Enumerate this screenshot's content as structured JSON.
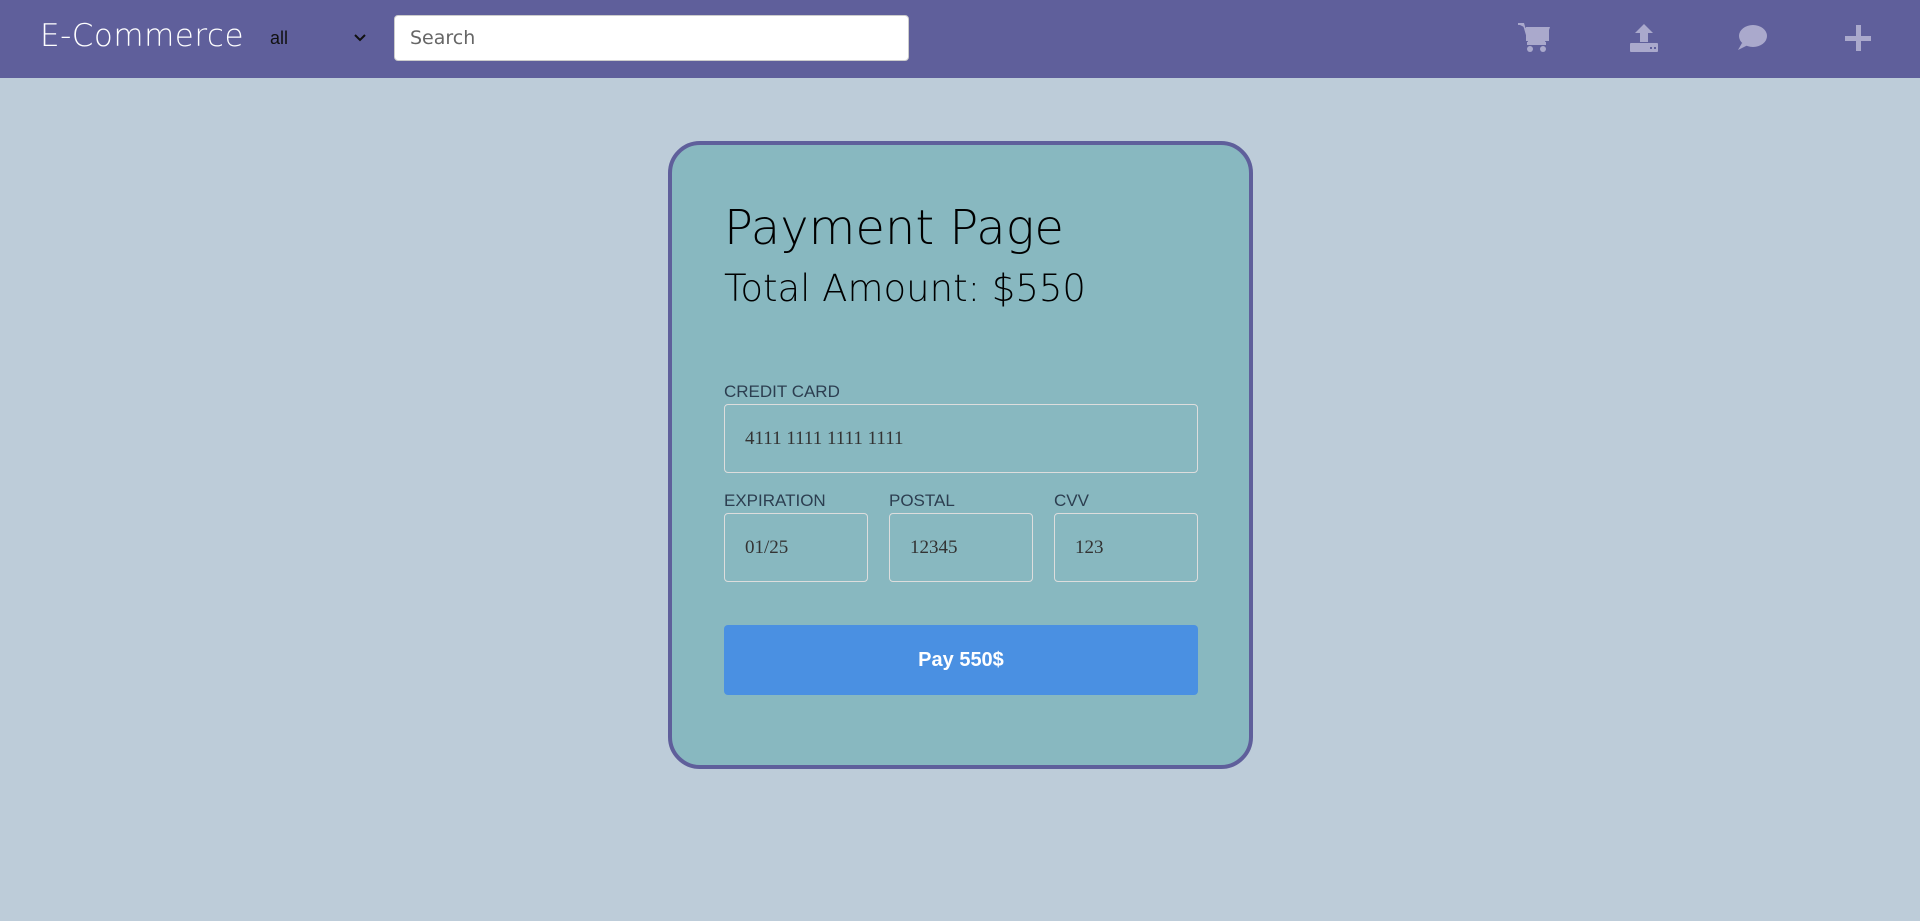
{
  "header": {
    "logo": "E-Commerce",
    "category": "all",
    "search_placeholder": "Search",
    "icons": [
      "cart-icon",
      "upload-icon",
      "chat-icon",
      "plus-icon"
    ]
  },
  "payment": {
    "title": "Payment Page",
    "total": "Total Amount: $550",
    "credit_card_label": "CREDIT CARD",
    "credit_card_value": "4111 1111 1111 1111",
    "expiration_label": "EXPIRATION",
    "expiration_value": "01/25",
    "postal_label": "POSTAL",
    "postal_value": "12345",
    "cvv_label": "CVV",
    "cvv_value": "123",
    "pay_label": "Pay 550$"
  },
  "colors": {
    "header": "#5f5f9b",
    "background": "#bdccd9",
    "card": "#88b8c0",
    "button": "#4a90e2",
    "icon": "#aaa9cc"
  }
}
